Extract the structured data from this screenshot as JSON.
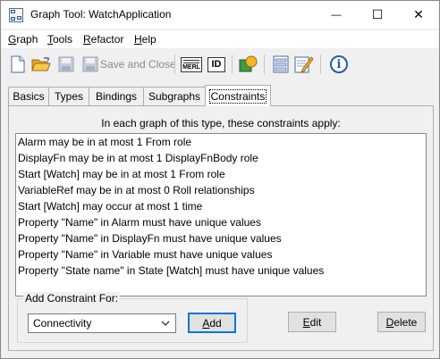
{
  "window": {
    "title": "Graph Tool: WatchApplication",
    "controls": {
      "minimize": "—",
      "maximize": "☐",
      "close": "✕"
    }
  },
  "menu": [
    {
      "label": "Graph",
      "accel": "G",
      "rest": "raph"
    },
    {
      "label": "Tools",
      "accel": "T",
      "rest": "ools"
    },
    {
      "label": "Refactor",
      "accel": "R",
      "rest": "efactor"
    },
    {
      "label": "Help",
      "accel": "H",
      "rest": "elp"
    }
  ],
  "toolbar": {
    "save_and_close": "Save and Close",
    "merl_badge": "MERL",
    "id_badge": "ID",
    "info_glyph": "i"
  },
  "tabs": [
    {
      "label": "Basics",
      "active": false
    },
    {
      "label": "Types",
      "active": false
    },
    {
      "label": "Bindings",
      "active": false
    },
    {
      "label": "Subgraphs",
      "active": false
    },
    {
      "label": "Constraints",
      "active": true
    }
  ],
  "constraints": {
    "heading": "In each graph of this type, these constraints apply:",
    "items": [
      "Alarm may be in at most 1 From role",
      "DisplayFn may be in at most 1 DisplayFnBody role",
      "Start [Watch] may be in at most 1 From role",
      "VariableRef may be in at most 0 Roll relationships",
      "Start [Watch] may occur at most 1 time",
      "Property \"Name\" in Alarm must have unique values",
      "Property \"Name\" in DisplayFn must have unique values",
      "Property \"Name\" in Variable must have unique values",
      "Property \"State name\" in State [Watch] must have unique values"
    ],
    "add_group_label": "Add Constraint For:",
    "add_select_value": "Connectivity",
    "add_button": {
      "accel": "A",
      "rest": "dd"
    },
    "edit_button": {
      "accel": "E",
      "rest": "dit"
    },
    "delete_button": {
      "accel": "D",
      "rest": "elete"
    }
  }
}
